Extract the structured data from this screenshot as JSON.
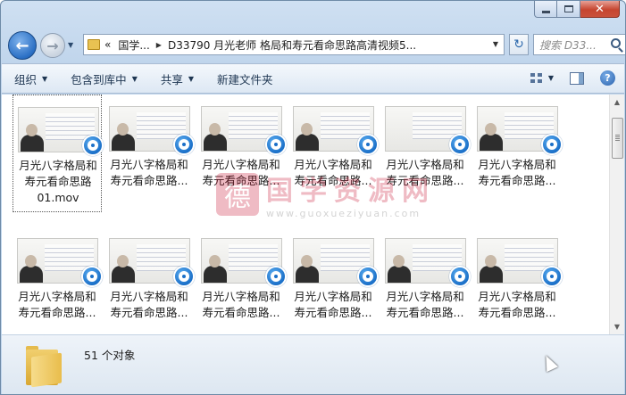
{
  "window": {
    "caption": {
      "minimize": "",
      "maximize": "",
      "close": "✕"
    }
  },
  "nav": {
    "back_glyph": "←",
    "forward_glyph": "→",
    "address": {
      "overflow": "«",
      "crumbs": [
        "国学...",
        "D33790 月光老师 格局和寿元看命思路高清视频5..."
      ]
    },
    "refresh_glyph": "↻",
    "search_placeholder": "搜索 D33..."
  },
  "toolbar": {
    "items": [
      "组织",
      "包含到库中",
      "共享",
      "新建文件夹"
    ]
  },
  "files": [
    {
      "line1": "月光八字格局和",
      "line2": "寿元看命思路",
      "line3": "01.mov"
    },
    {
      "line1": "月光八字格局和",
      "line2": "寿元看命思路...",
      "line3": ""
    },
    {
      "line1": "月光八字格局和",
      "line2": "寿元看命思路...",
      "line3": ""
    },
    {
      "line1": "月光八字格局和",
      "line2": "寿元看命思路...",
      "line3": ""
    },
    {
      "line1": "月光八字格局和",
      "line2": "寿元看命思路...",
      "line3": ""
    },
    {
      "line1": "月光八字格局和",
      "line2": "寿元看命思路...",
      "line3": ""
    },
    {
      "line1": "月光八字格局和",
      "line2": "寿元看命思路...",
      "line3": ""
    },
    {
      "line1": "月光八字格局和",
      "line2": "寿元看命思路...",
      "line3": ""
    },
    {
      "line1": "月光八字格局和",
      "line2": "寿元看命思路...",
      "line3": ""
    },
    {
      "line1": "月光八字格局和",
      "line2": "寿元看命思路...",
      "line3": ""
    },
    {
      "line1": "月光八字格局和",
      "line2": "寿元看命思路...",
      "line3": ""
    },
    {
      "line1": "月光八字格局和",
      "line2": "寿元看命思路...",
      "line3": ""
    }
  ],
  "watermark": {
    "seal": "德",
    "text": "国学资源网",
    "url": "www.guoxueziyuan.com"
  },
  "status": {
    "count": "51 个对象"
  },
  "colors": {
    "accent": "#2a6fc4",
    "window_frame": "#c0d5ec",
    "watermark": "#c8102e"
  }
}
